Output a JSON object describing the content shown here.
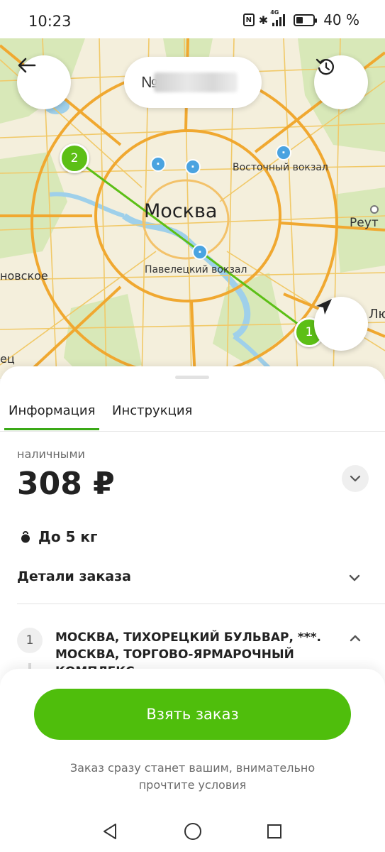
{
  "status_bar": {
    "time": "10:23",
    "network": "4G",
    "battery_percent_label": "40 %",
    "battery_level": 0.4
  },
  "map": {
    "title_visible_text": "№",
    "labels": {
      "city": "Москва",
      "vostochny": "Восточный вокзал",
      "paveletsky": "Павелецкий вокзал",
      "reutov": "Реут",
      "west": "новское",
      "southwest": "ец",
      "east": "Лю"
    },
    "pin_1": "1",
    "pin_2": "2",
    "route_color": "#5cbf16"
  },
  "tabs": [
    {
      "label": "Информация",
      "active": true
    },
    {
      "label": "Инструкция",
      "active": false
    }
  ],
  "order": {
    "payment_label": "наличными",
    "price": "308 ₽",
    "weight": "До 5 кг",
    "details_label": "Детали заказа",
    "route_point_number": "1",
    "route_text": "МОСКВА, ТИХОРЕЦКИЙ БУЛЬВАР, ***. МОСКВА, ТОРГОВО-ЯРМАРОЧНЫЙ КОМПЛЕКС"
  },
  "actions": {
    "take_order_label": "Взять заказ",
    "note": "Заказ сразу станет вашим, внимательно прочтите условия"
  },
  "colors": {
    "accent_green": "#4fbe0c",
    "tab_underline": "#3aa917"
  },
  "icons": {
    "back": "arrow-left",
    "refresh": "rotate-ccw",
    "locate": "navigation-arrow",
    "weight": "kettlebell",
    "expand": "chevron-down",
    "collapse": "chevron-up"
  }
}
